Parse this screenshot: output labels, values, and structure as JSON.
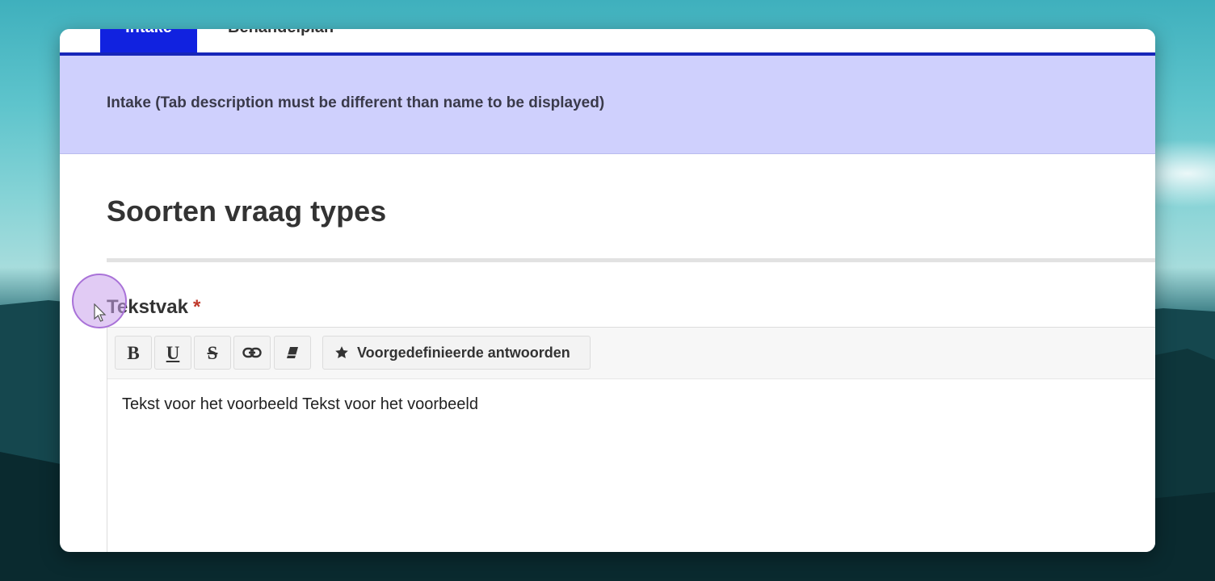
{
  "tabs": [
    {
      "label": "Intake",
      "active": true
    },
    {
      "label": "Behandelplan",
      "active": false
    }
  ],
  "tab_description": "Intake (Tab description must be different than name to be displayed)",
  "section": {
    "title": "Soorten vraag types"
  },
  "field": {
    "label": "Tekstvak",
    "required_marker": "*"
  },
  "toolbar": {
    "bold_label": "B",
    "underline_label": "U",
    "strike_label": "S",
    "predefined_label": "Voorgedefinieerde antwoorden",
    "icons": [
      "link-icon",
      "eraser-icon",
      "star-icon"
    ]
  },
  "editor": {
    "content": "Tekst voor het voorbeeld Tekst voor het voorbeeld"
  },
  "colors": {
    "tab_active_bg": "#1122e0",
    "tab_rule": "#1726b9",
    "description_bg": "#cfd0fd",
    "required": "#c0392b",
    "cursor_highlight": "#a972d8"
  }
}
